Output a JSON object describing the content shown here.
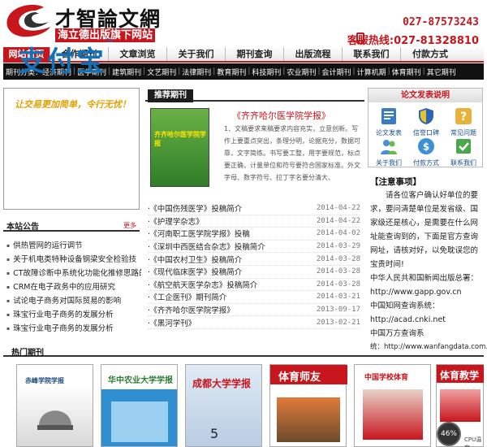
{
  "header": {
    "logo_title": "才智論文網",
    "logo_subtitle": "海立德出版旗下网站",
    "phone_1": "027-87573243",
    "phone_2": "客服热线:027-81328810"
  },
  "nav": [
    "网站首页",
    "合作期刊",
    "文章浏览",
    "关于我们",
    "期刊查询",
    "出版流程",
    "联系我们",
    "付款方式"
  ],
  "categories": {
    "label": "期刊分类：",
    "items": [
      "经济期刊",
      "医学期刊",
      "建筑期刊",
      "文艺期刊",
      "法律期刊",
      "教育期刊",
      "科技期刊",
      "农业期刊",
      "会计期刊",
      "计算机期",
      "体育期刊",
      "其它期刊"
    ]
  },
  "ad": {
    "logo": "支付宝",
    "tm": "TM",
    "slogan": "让交易更加简单，令行无忧！"
  },
  "announcement": {
    "title": "本站公告",
    "more": "更多",
    "items": [
      "供热管网的运行调节",
      "关于机电类特种设备钢梁安全检验技",
      "CT故障诊断中系统化功能化推修思路的",
      "CRM在电子政务中的应用研究",
      "试论电子商务对国际贸易的影响",
      "珠宝行业电子商务的发展分析",
      "珠宝行业电子商务的发展分析"
    ]
  },
  "recommend": {
    "title": "推荐期刊",
    "cover_title": "齐齐哈尔医学院学报",
    "name": "《齐齐哈尔医学院学报》",
    "desc": "1、文稿要求来稿要求内容充实，立意创新。写作上要重点突出，条理分明，论据充分，数据可靠，文字简练。书写要工整，用字要规范，标点要正确，计量单位和符号要符合国家标准。外文字母、数字符号、拉丁字名要分清大、"
  },
  "articles": [
    {
      "title": "《中国伤残医学》投稿简介",
      "date": "2014-04-22"
    },
    {
      "title": "《护理学杂志》",
      "date": "2014-04-22"
    },
    {
      "title": "《河南职工医学院学报》投稿",
      "date": "2014-04-02"
    },
    {
      "title": "《深圳中西医结合杂志》投稿简介",
      "date": "2014-03-29"
    },
    {
      "title": "《中国农村卫生》投稿简介",
      "date": "2014-03-28"
    },
    {
      "title": "《现代临床医学》投稿简介",
      "date": "2014-03-28"
    },
    {
      "title": "《航空航天医学杂志》投稿简介",
      "date": "2014-03-28"
    },
    {
      "title": "《工企医刊》期刊简介",
      "date": "2014-03-21"
    },
    {
      "title": "《齐齐哈尔医学院学报》",
      "date": "2013-09-17"
    },
    {
      "title": "《黑河学刊》",
      "date": "2013-02-21"
    }
  ],
  "guide": {
    "title": "论文发表说明",
    "items": [
      "论文发表",
      "信誉口碑",
      "常见问题",
      "关于我们",
      "付款方式",
      "联系我们"
    ]
  },
  "notice": {
    "title": "【注意事项】",
    "paragraph": "请各位客户确认好单位的要求，要问清楚单位是发省级、国家级还是核心，是需要在什么网址能查询到的，下面是官方查询网址，请核对好，以免耽误您的宝贵时间!",
    "lines": [
      "中华人民共和国新闻出版总署：",
      "http://www.gapp.gov.cn",
      "中国知网查询系统：",
      "http://acad.cnki.net",
      "中国万方查询系",
      "统：http://www.wanfangdata.com.cn/"
    ]
  },
  "hot": {
    "title": "热门期刊",
    "covers": [
      "赤峰学院学报",
      "华中农业大学学报",
      "成都大学学报",
      "体育师友",
      "中国学校体育",
      "体育教学"
    ]
  },
  "cpu": {
    "value": "46%",
    "label": "CPU温度"
  }
}
